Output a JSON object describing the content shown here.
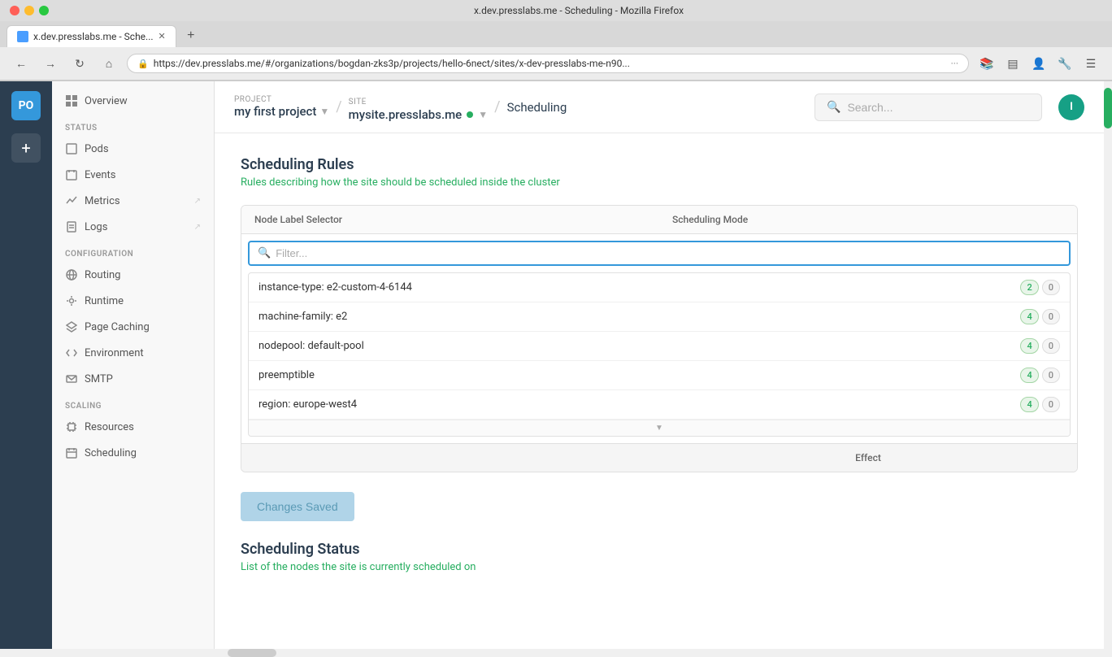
{
  "browser": {
    "title": "x.dev.presslabs.me - Scheduling - Mozilla Firefox",
    "tab_label": "x.dev.presslabs.me - Sche...",
    "address": "https://dev.presslabs.me/#/organizations/bogdan-zks3p/projects/hello-6nect/sites/x-dev-presslabs-me-n90...",
    "dots": [
      "red",
      "yellow",
      "green"
    ]
  },
  "header": {
    "project_label": "PROJECT",
    "project_name": "my first project",
    "site_label": "SITE",
    "site_name": "mysite.presslabs.me",
    "page_title": "Scheduling",
    "search_placeholder": "Search...",
    "user_initials": "I"
  },
  "sidebar": {
    "avatar": "PO",
    "add_label": "+",
    "nav_items": [
      {
        "id": "overview",
        "label": "Overview",
        "icon": "grid"
      },
      {
        "id": "pods",
        "label": "Pods",
        "icon": "box",
        "section": "STATUS"
      },
      {
        "id": "events",
        "label": "Events",
        "icon": "calendar"
      },
      {
        "id": "metrics",
        "label": "Metrics",
        "icon": "chart",
        "ext": true
      },
      {
        "id": "logs",
        "label": "Logs",
        "icon": "file",
        "ext": true
      },
      {
        "id": "routing",
        "label": "Routing",
        "icon": "globe",
        "section": "CONFIGURATION"
      },
      {
        "id": "runtime",
        "label": "Runtime",
        "icon": "settings"
      },
      {
        "id": "page-caching",
        "label": "Page Caching",
        "icon": "layers"
      },
      {
        "id": "environment",
        "label": "Environment",
        "icon": "code"
      },
      {
        "id": "smtp",
        "label": "SMTP",
        "icon": "mail"
      },
      {
        "id": "resources",
        "label": "Resources",
        "icon": "cpu",
        "section": "SCALING"
      },
      {
        "id": "scheduling",
        "label": "Scheduling",
        "icon": "calendar2"
      }
    ]
  },
  "scheduling_rules": {
    "title": "Scheduling Rules",
    "description": "Rules describing how the site should be scheduled inside the cluster",
    "col1": "Node Label Selector",
    "col2": "Scheduling Mode",
    "filter_placeholder": "Filter...",
    "dropdown_items": [
      {
        "label": "instance-type: e2-custom-4-6144",
        "count_green": "2",
        "count_gray": "0"
      },
      {
        "label": "machine-family: e2",
        "count_green": "4",
        "count_gray": "0"
      },
      {
        "label": "nodepool: default-pool",
        "count_green": "4",
        "count_gray": "0"
      },
      {
        "label": "preemptible",
        "count_green": "4",
        "count_gray": "0"
      },
      {
        "label": "region: europe-west4",
        "count_green": "4",
        "count_gray": "0"
      }
    ],
    "effect_label": "Effect",
    "changes_saved": "Changes Saved"
  },
  "scheduling_status": {
    "title": "Scheduling Status",
    "description": "List of the nodes the site is currently scheduled on"
  }
}
